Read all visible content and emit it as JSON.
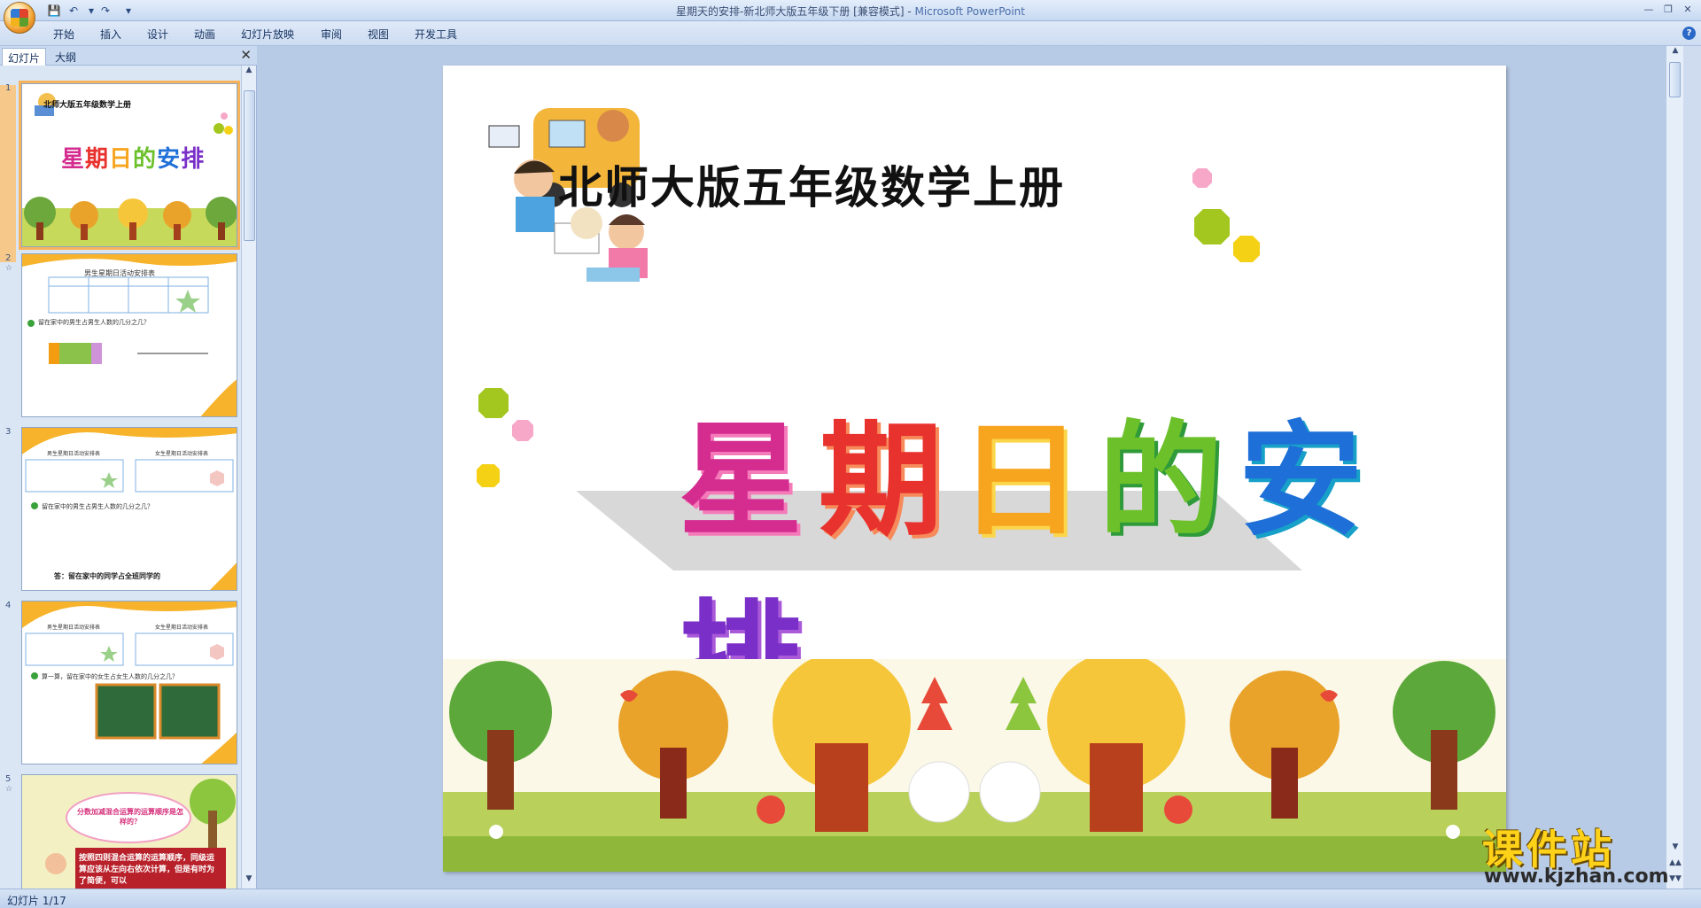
{
  "window": {
    "title": "星期天的安排-新北师大版五年级下册 [兼容模式] - ",
    "app_name": "Microsoft PowerPoint"
  },
  "ribbon_tabs": [
    "开始",
    "插入",
    "设计",
    "动画",
    "幻灯片放映",
    "审阅",
    "视图",
    "开发工具"
  ],
  "quick_access": {
    "save_icon": "save-icon",
    "undo_icon": "undo-icon",
    "redo_icon": "redo-icon",
    "customize_icon": "dropdown-icon"
  },
  "left_pane": {
    "tabs": [
      {
        "label": "幻灯片",
        "active": true
      },
      {
        "label": "大纲",
        "active": false
      }
    ],
    "thumbnails": [
      {
        "number": "1",
        "selected": true,
        "subtitle": "北师大版五年级数学上册",
        "title": "星期日的安排"
      },
      {
        "number": "2",
        "selected": false,
        "table_title": "男生星期日活动安排表",
        "question": "留在家中的男生占男生人数的几分之几？"
      },
      {
        "number": "3",
        "selected": false,
        "table_title": "男生星期日活动安排表",
        "table_title_2": "女生星期日活动安排表",
        "question": "留在家中的男生占男生人数的几分之几？",
        "answer": "答：留在家中的同学占全班同学的"
      },
      {
        "number": "4",
        "selected": false,
        "table_title": "男生星期日活动安排表",
        "table_title_2": "女生星期日活动安排表",
        "question": "算一算，留在家中的女生占女生人数的几分之几？"
      },
      {
        "number": "5",
        "selected": false,
        "bubble": "分数加减混合运算的运算顺序是怎样的？",
        "note": "按照四则混合运算的运算顺序，同级运算应该从左向右依次计算，但是有时为了简便，可以"
      }
    ]
  },
  "slide": {
    "subtitle": "北师大版五年级数学上册",
    "title_chars": [
      {
        "char": "星",
        "color": "#d42c8f"
      },
      {
        "char": "期",
        "color": "#e8322e"
      },
      {
        "char": "日",
        "color": "#f7a51e"
      },
      {
        "char": "的",
        "color": "#6cc12b"
      },
      {
        "char": "安",
        "color": "#1e6fd8"
      },
      {
        "char": "排",
        "color": "#7b2fc9"
      }
    ]
  },
  "status": {
    "slide_counter": "幻灯片 1/17"
  },
  "watermark": {
    "title": "课件站",
    "url": "www.kjzhan.com"
  }
}
